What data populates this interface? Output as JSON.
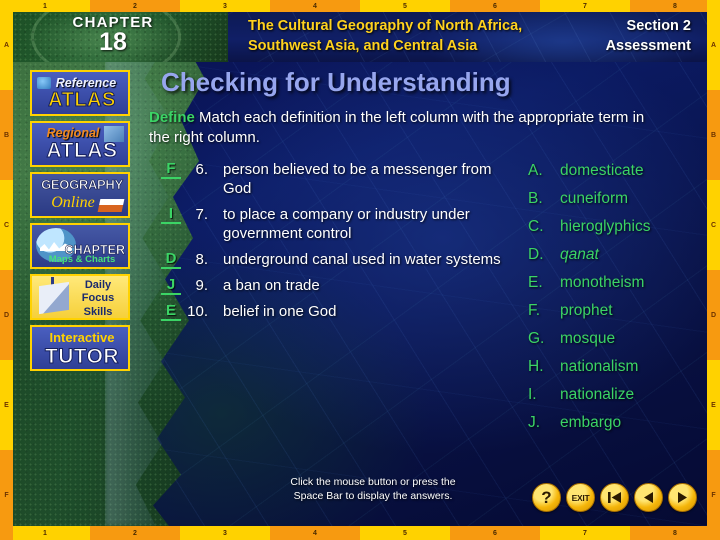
{
  "rulers": {
    "top_labels": [
      "1",
      "2",
      "3",
      "4",
      "5",
      "6",
      "7",
      "8"
    ],
    "bottom_labels": [
      "1",
      "2",
      "3",
      "4",
      "5",
      "6",
      "7",
      "8"
    ],
    "side_labels": [
      "A",
      "B",
      "C",
      "D",
      "E",
      "F"
    ]
  },
  "header": {
    "chapter_word": "CHAPTER",
    "chapter_number": "18",
    "book_title": "The Cultural Geography of North Africa, Southwest Asia, and Central Asia",
    "section_line1": "Section 2",
    "section_line2": "Assessment"
  },
  "sidebar": {
    "items": [
      {
        "name": "reference-atlas",
        "line1": "Reference",
        "line2": "ATLAS"
      },
      {
        "name": "regional-atlas",
        "line1": "Regional",
        "line2": "ATLAS"
      },
      {
        "name": "geography-online",
        "line1": "GEOGRAPHY",
        "line2": "Online"
      },
      {
        "name": "chapter-maps-charts",
        "line1": "CHAPTER",
        "line2": "Maps & Charts"
      },
      {
        "name": "daily-focus-skills",
        "line1": "Daily Focus Skills",
        "line2": ""
      },
      {
        "name": "interactive-tutor",
        "line1": "Interactive",
        "line2": "TUTOR"
      }
    ]
  },
  "main": {
    "title": "Checking for Understanding",
    "instruction_label": "Define",
    "instruction_text": "Match each definition in the left column with the appropriate term in the right column.",
    "questions": [
      {
        "answer": "F",
        "number": "6.",
        "text": "person believed to be a messenger from God"
      },
      {
        "answer": "I",
        "number": "7.",
        "text": "to place a company or industry under government control"
      },
      {
        "answer": "D",
        "number": "8.",
        "text": "underground canal used in water systems"
      },
      {
        "answer": "J",
        "number": "9.",
        "text": "a ban on trade"
      },
      {
        "answer": "E",
        "number": "10.",
        "text": "belief in one God"
      }
    ],
    "terms": [
      {
        "letter": "A.",
        "term": "domesticate",
        "italic": false
      },
      {
        "letter": "B.",
        "term": "cuneiform",
        "italic": false
      },
      {
        "letter": "C.",
        "term": "hieroglyphics",
        "italic": false
      },
      {
        "letter": "D.",
        "term": "qanat",
        "italic": true
      },
      {
        "letter": "E.",
        "term": "monotheism",
        "italic": false
      },
      {
        "letter": "F.",
        "term": "prophet",
        "italic": false
      },
      {
        "letter": "G.",
        "term": "mosque",
        "italic": false
      },
      {
        "letter": "H.",
        "term": "nationalism",
        "italic": false
      },
      {
        "letter": "I.",
        "term": "nationalize",
        "italic": false
      },
      {
        "letter": "J.",
        "term": "embargo",
        "italic": false
      }
    ]
  },
  "footer": {
    "hint_line1": "Click the mouse button or press the",
    "hint_line2": "Space Bar to display the answers.",
    "nav_buttons": [
      {
        "name": "help-button",
        "label": "?"
      },
      {
        "name": "exit-button",
        "label": "EXIT"
      },
      {
        "name": "first-button",
        "label": ""
      },
      {
        "name": "previous-button",
        "label": ""
      },
      {
        "name": "next-button",
        "label": ""
      }
    ]
  },
  "colors": {
    "ruler_yellow": "#ffd200",
    "ruler_orange": "#f79a10",
    "title_blue": "#97a6ee",
    "accent_green": "#3bd465",
    "header_gold": "#ffd21e"
  }
}
